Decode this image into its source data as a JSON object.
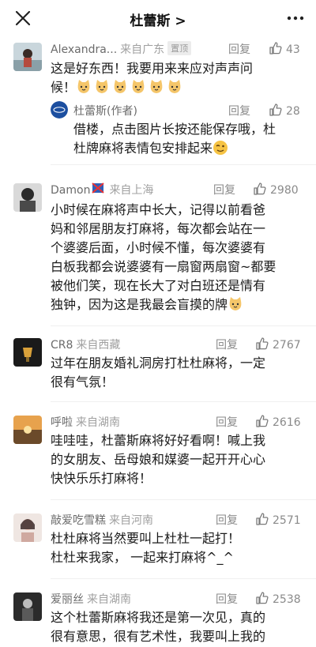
{
  "header": {
    "title": "杜蕾斯 >"
  },
  "comments": [
    {
      "user": "Alexandra...",
      "location": "来自广东",
      "badge": "置顶",
      "reply": "回复",
      "likes": "43",
      "lines": [
        "这是好东西！我要用来来应对声声问",
        "候！"
      ],
      "emoji_count": 6,
      "sub": {
        "user": "杜蕾斯(作者)",
        "reply": "回复",
        "likes": "28",
        "lines": [
          "借楼，点击图片长按还能保存哦，杜",
          "杜牌麻将表情包安排起来"
        ]
      }
    },
    {
      "user": "Damon",
      "location": "来自上海",
      "reply": "回复",
      "likes": "2980",
      "lines": [
        "小时候在麻将声中长大，记得以前看爸",
        "妈和邻居朋友打麻将，每次都会站在一",
        "个婆婆后面，小时候不懂，每次婆婆有",
        "白板我都会说婆婆有一扇窗两扇窗~都要",
        "被他们笑，现在长大了对白班还是情有",
        "独钟，因为这是我最会盲摸的牌"
      ]
    },
    {
      "user": "CR8",
      "location": "来自西藏",
      "reply": "回复",
      "likes": "2767",
      "lines": [
        "过年在朋友婚礼洞房打杜杜麻将，一定",
        "很有气氛！"
      ]
    },
    {
      "user": "呼啦",
      "location": "来自湖南",
      "reply": "回复",
      "likes": "2616",
      "lines": [
        "哇哇哇，杜蕾斯麻将好好看啊！喊上我",
        "的女朋友、岳母娘和媒婆一起开开心心",
        "快快乐乐打麻将！"
      ]
    },
    {
      "user": "敲爱吃雪糕",
      "location": "来自河南",
      "reply": "回复",
      "likes": "2571",
      "lines": [
        "杜杜麻将当然要叫上杜杜一起打！",
        "杜杜来我家， 一起来打麻将^_^"
      ]
    },
    {
      "user": "爱丽丝",
      "location": "来自湖南",
      "reply": "回复",
      "likes": "2538",
      "lines": [
        "这个杜蕾斯麻将我还是第一次见，真的",
        "很有意思，很有艺术性，我要叫上我的"
      ]
    }
  ],
  "colors": {
    "text": "#1a1a1a",
    "meta": "#8a8a8a",
    "background": "#ffffff"
  }
}
